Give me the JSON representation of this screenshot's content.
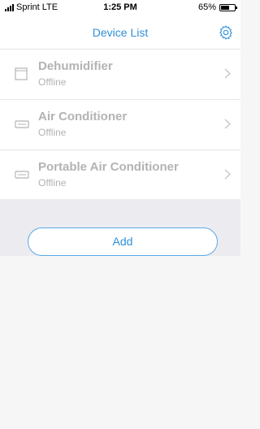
{
  "status_bar": {
    "carrier": "Sprint",
    "network": "LTE",
    "time": "1:25 PM",
    "battery": "65%",
    "battery_level": 0.65
  },
  "nav": {
    "title": "Device List",
    "settings_icon": "gear-icon"
  },
  "devices": [
    {
      "name": "Dehumidifier",
      "status": "Offline",
      "icon": "dehumidifier-icon"
    },
    {
      "name": "Air Conditioner",
      "status": "Offline",
      "icon": "air-conditioner-icon"
    },
    {
      "name": "Portable Air Conditioner",
      "status": "Offline",
      "icon": "portable-air-conditioner-icon"
    }
  ],
  "actions": {
    "add_label": "Add"
  },
  "colors": {
    "accent": "#2f8fd8",
    "muted_text": "#b3b3b3",
    "section_bg": "#ececf0"
  }
}
